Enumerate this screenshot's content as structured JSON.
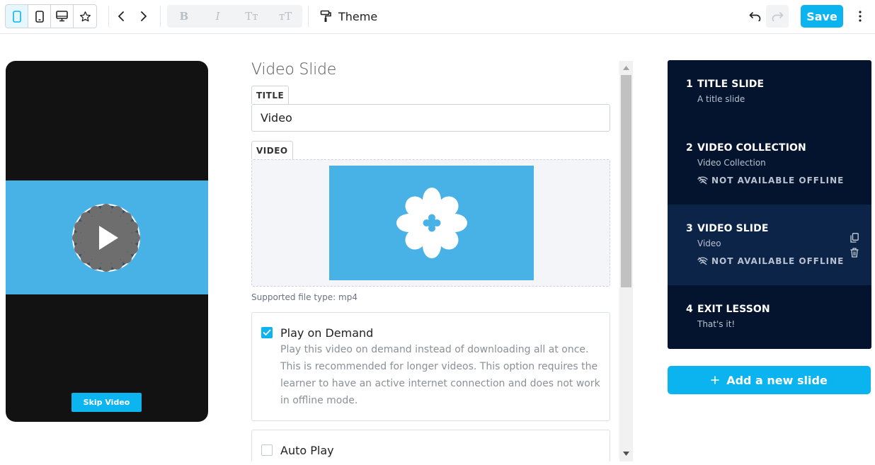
{
  "toolbar": {
    "device_buttons": [
      "phone-portrait",
      "tablet",
      "desktop",
      "favorites"
    ],
    "format_buttons": [
      "B",
      "I",
      "Tт",
      "тT"
    ],
    "theme_label": "Theme",
    "save_label": "Save"
  },
  "preview": {
    "skip_label": "Skip Video"
  },
  "editor": {
    "heading": "Video Slide",
    "title_tag": "TITLE",
    "title_value": "Video",
    "video_tag": "VIDEO",
    "file_hint": "Supported file type: mp4",
    "options": [
      {
        "label": "Play on Demand",
        "checked": true,
        "description": "Play this video on demand instead of downloading all at once. This is recommended for longer videos. This option requires the learner to have an active internet connection and does not work in offline mode."
      },
      {
        "label": "Auto Play",
        "checked": false
      }
    ]
  },
  "slides": [
    {
      "number": "1",
      "title": "TITLE SLIDE",
      "subtitle": "A title slide"
    },
    {
      "number": "2",
      "title": "VIDEO COLLECTION",
      "subtitle": "Video Collection",
      "offline": "NOT AVAILABLE OFFLINE"
    },
    {
      "number": "3",
      "title": "VIDEO SLIDE",
      "subtitle": "Video",
      "offline": "NOT AVAILABLE OFFLINE",
      "active": true
    },
    {
      "number": "4",
      "title": "EXIT LESSON",
      "subtitle": "That's it!"
    }
  ],
  "add_slide_label": "Add a new slide",
  "colors": {
    "accent": "#0bb4ef",
    "slide_panel": "#05142e",
    "slide_active": "#0b2447",
    "video_blue": "#48b1e6"
  }
}
